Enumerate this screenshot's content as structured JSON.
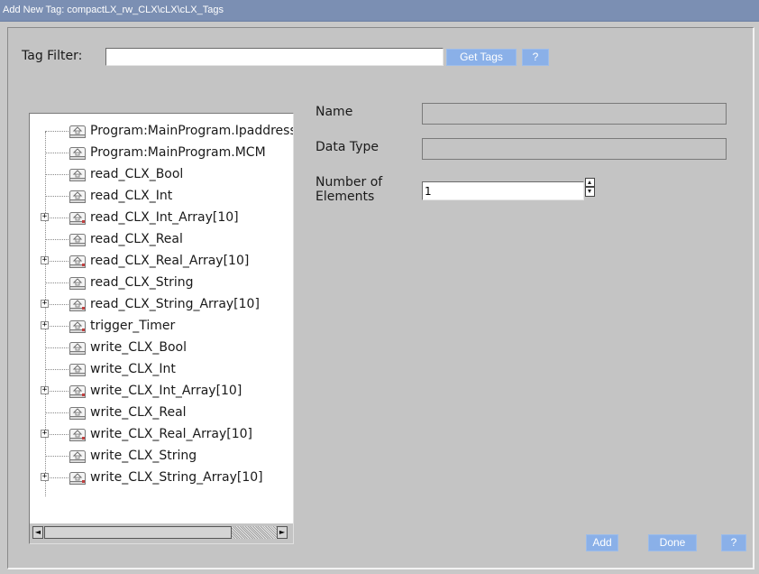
{
  "window": {
    "title": "Add New Tag: compactLX_rw_CLX\\cLX\\cLX_Tags"
  },
  "filter": {
    "label": "Tag Filter:",
    "value": "",
    "get_tags_label": "Get Tags",
    "help_label": "?"
  },
  "tree": {
    "items": [
      {
        "label": "Program:MainProgram.Ipaddress",
        "expandable": false
      },
      {
        "label": "Program:MainProgram.MCM",
        "expandable": false
      },
      {
        "label": "read_CLX_Bool",
        "expandable": false
      },
      {
        "label": "read_CLX_Int",
        "expandable": false
      },
      {
        "label": "read_CLX_Int_Array[10]",
        "expandable": true
      },
      {
        "label": "read_CLX_Real",
        "expandable": false
      },
      {
        "label": "read_CLX_Real_Array[10]",
        "expandable": true
      },
      {
        "label": "read_CLX_String",
        "expandable": false
      },
      {
        "label": "read_CLX_String_Array[10]",
        "expandable": true
      },
      {
        "label": "trigger_Timer",
        "expandable": true
      },
      {
        "label": "write_CLX_Bool",
        "expandable": false
      },
      {
        "label": "write_CLX_Int",
        "expandable": false
      },
      {
        "label": "write_CLX_Int_Array[10]",
        "expandable": true
      },
      {
        "label": "write_CLX_Real",
        "expandable": false
      },
      {
        "label": "write_CLX_Real_Array[10]",
        "expandable": true
      },
      {
        "label": "write_CLX_String",
        "expandable": false
      },
      {
        "label": "write_CLX_String_Array[10]",
        "expandable": true
      }
    ],
    "expander_glyph": "+",
    "node_icon": "tag-icon",
    "scroll_left_glyph": "◄",
    "scroll_right_glyph": "►"
  },
  "form": {
    "name_label": "Name",
    "name_value": "",
    "data_type_label": "Data Type",
    "data_type_value": "",
    "num_elements_label_1": "Number of",
    "num_elements_label_2": "Elements",
    "num_elements_value": "1"
  },
  "actions": {
    "add_label": "Add",
    "done_label": "Done",
    "help_label": "?"
  },
  "colors": {
    "title_bar": "#7b8fb3",
    "button": "#8ab0e8",
    "dialog_bg": "#c4c4c4",
    "tag_icon_marker": "#c04040"
  }
}
